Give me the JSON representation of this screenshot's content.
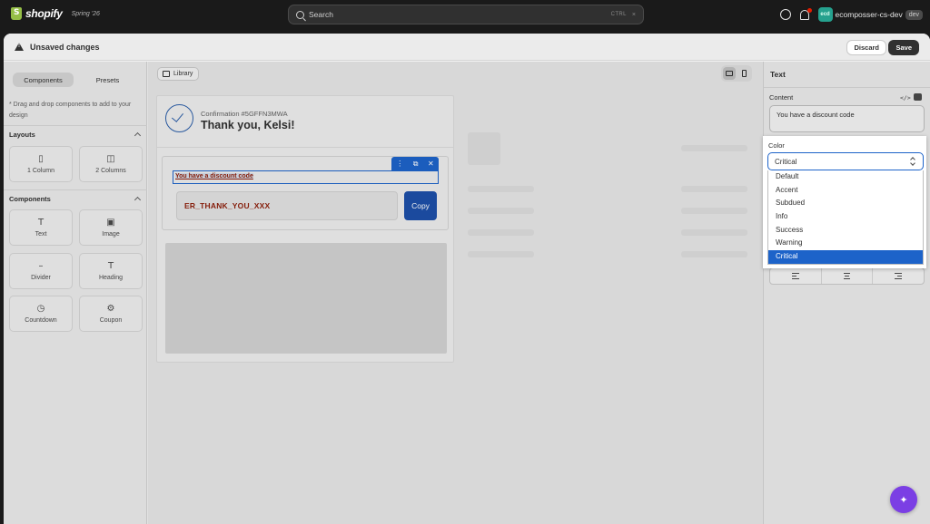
{
  "topbar": {
    "logo_text": "shopify",
    "edition": "Spring '26",
    "search_placeholder": "Search",
    "search_shortcut": "CTRL",
    "search_clear": "×",
    "store_avatar": "ecd",
    "store_name": "ecomposser-cs-dev",
    "store_badge": "dev"
  },
  "save_bar": {
    "title": "Unsaved changes",
    "discard_label": "Discard",
    "save_label": "Save"
  },
  "left_panel": {
    "tabs": [
      {
        "label": "Components",
        "active": true
      },
      {
        "label": "Presets",
        "active": false
      }
    ],
    "hint": "* Drag and drop components to add to your design",
    "layouts_title": "Layouts",
    "layouts": [
      {
        "label": "1 Column",
        "icon": "single-column-icon"
      },
      {
        "label": "2 Columns",
        "icon": "two-columns-icon"
      }
    ],
    "components_title": "Components",
    "components": [
      {
        "label": "Text",
        "icon": "text-icon"
      },
      {
        "label": "Image",
        "icon": "image-icon"
      },
      {
        "label": "Divider",
        "icon": "divider-icon"
      },
      {
        "label": "Heading",
        "icon": "heading-icon"
      },
      {
        "label": "Countdown",
        "icon": "clock-icon"
      },
      {
        "label": "Coupon",
        "icon": "coupon-icon"
      }
    ]
  },
  "canvas": {
    "library_label": "Library",
    "confirmation": "Confirmation #5GFFN3MWA",
    "thanks": "Thank you, Kelsi!",
    "discount_text": "You have a discount code",
    "code": "ER_THANK_YOU_XXX",
    "copy_label": "Copy",
    "toolbar_icons": {
      "more": "⋮",
      "duplicate": "⧉",
      "close": "✕"
    }
  },
  "right_panel": {
    "title": "Text",
    "content_label": "Content",
    "content_value": "You have a discount code",
    "code_icon": "</>",
    "color_label": "Color",
    "color_selected": "Critical",
    "color_options": [
      "Default",
      "Accent",
      "Subdued",
      "Info",
      "Success",
      "Warning",
      "Critical"
    ]
  },
  "colors": {
    "accent": "#1d63c9",
    "critical_text": "#8e1f0b",
    "copy_button": "#1d4fa8",
    "fab": "#7b3fe4"
  },
  "fab_icon": "✦"
}
